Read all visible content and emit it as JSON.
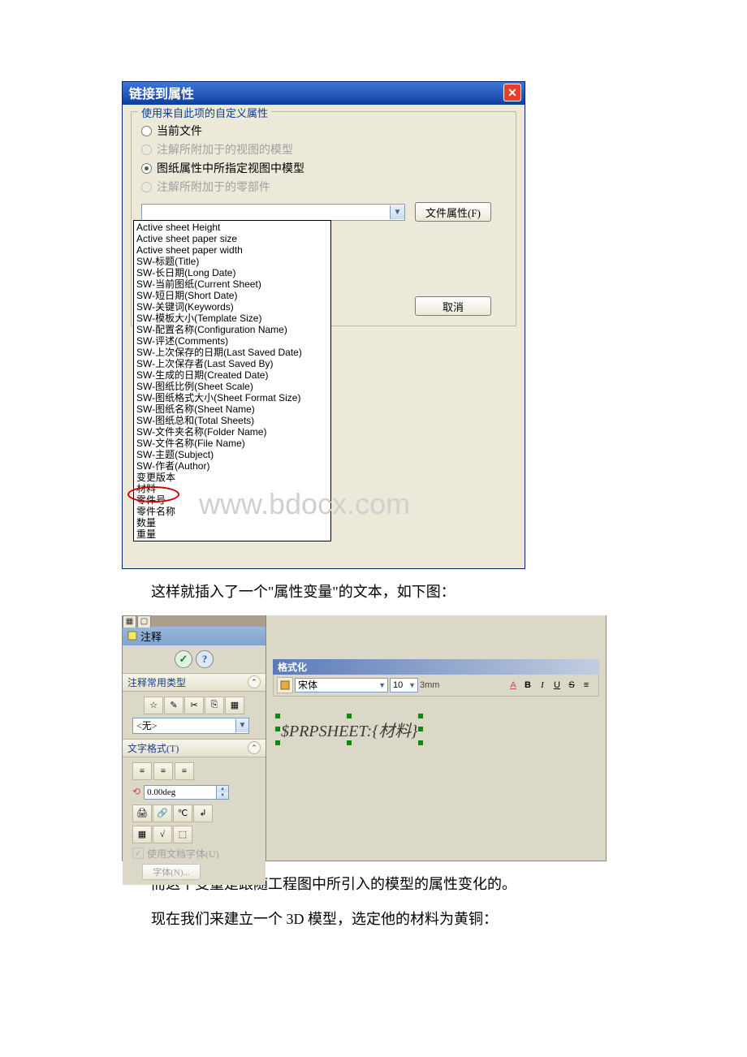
{
  "dialog1": {
    "title": "链接到属性",
    "group_title": "使用来自此项的自定义属性",
    "radios": {
      "r1": "当前文件",
      "r2": "注解所附加于的视图的模型",
      "r3": "图纸属性中所指定视图中模型",
      "r4": "注解所附加于的零部件"
    },
    "btn_file_props": "文件属性(F)",
    "btn_cancel": "取消",
    "list": {
      "i0": "Active sheet Height",
      "i1": "Active sheet paper size",
      "i2": "Active sheet paper width",
      "i3": "SW-标题(Title)",
      "i4": "SW-长日期(Long Date)",
      "i5": "SW-当前图纸(Current Sheet)",
      "i6": "SW-短日期(Short Date)",
      "i7": "SW-关键词(Keywords)",
      "i8": "SW-模板大小(Template Size)",
      "i9": "SW-配置名称(Configuration Name)",
      "i10": "SW-评述(Comments)",
      "i11": "SW-上次保存的日期(Last Saved Date)",
      "i12": "SW-上次保存者(Last Saved By)",
      "i13": "SW-生成的日期(Created Date)",
      "i14": "SW-图纸比例(Sheet Scale)",
      "i15": "SW-图纸格式大小(Sheet Format Size)",
      "i16": "SW-图纸名称(Sheet Name)",
      "i17": "SW-图纸总和(Total Sheets)",
      "i18": "SW-文件夹名称(Folder Name)",
      "i19": "SW-文件名称(File Name)",
      "i20": "SW-主题(Subject)",
      "i21": "SW-作者(Author)",
      "i22": "变更版本",
      "i23": "材料",
      "i24": "零件号",
      "i25": "零件名称",
      "i26": "数量",
      "i27": "重量"
    }
  },
  "para1": "这样就插入了一个\"属性变量\"的文本，如下图：",
  "shot2": {
    "anno_header": "注释",
    "sec1": "注释常用类型",
    "none_option": "<无>",
    "sec2": "文字格式(T)",
    "deg_value": "0.00deg",
    "use_doc_font": "使用文档字体(U)",
    "font_btn": "字体(N)...",
    "fmt_title": "格式化",
    "font_name": "宋体",
    "font_size": "10",
    "unit": "3mm",
    "variable_text": "$PRPSHEET:{材料}"
  },
  "para2": "而这个变量是跟随工程图中所引入的模型的属性变化的。",
  "para3": "现在我们来建立一个 3D 模型，选定他的材料为黄铜：",
  "watermark": "www.bdocx.com"
}
